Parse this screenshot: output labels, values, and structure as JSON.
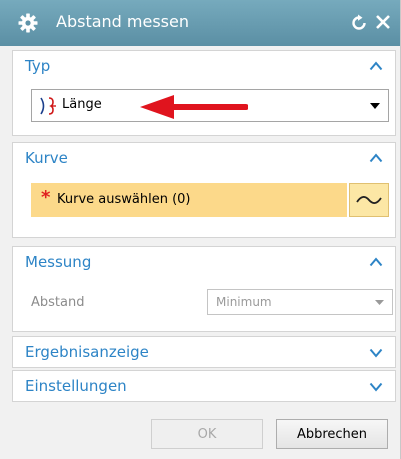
{
  "dialog": {
    "title": "Abstand messen",
    "icons": {
      "settings": "gear-icon",
      "reset": "reset-icon",
      "close": "close-icon"
    }
  },
  "sections": {
    "typ": {
      "label": "Typ",
      "state": "expanded",
      "type_combo": {
        "value": "Länge",
        "icon": "curve-length-icon"
      }
    },
    "kurve": {
      "label": "Kurve",
      "state": "expanded",
      "required_marker": "*",
      "select_label": "Kurve auswählen (0)",
      "select_icon": "curve-icon"
    },
    "messung": {
      "label": "Messung",
      "state": "expanded",
      "field_label": "Abstand",
      "field_value": "Minimum"
    },
    "ergebnisanzeige": {
      "label": "Ergebnisanzeige",
      "state": "collapsed"
    },
    "einstellungen": {
      "label": "Einstellungen",
      "state": "collapsed"
    }
  },
  "buttons": {
    "ok": "OK",
    "cancel": "Abbrechen"
  },
  "colors": {
    "titlebar": "#6a9fb3",
    "section_label": "#2d84c6",
    "selection_highlight": "#fcd98a",
    "annotation_arrow": "#e0141e"
  }
}
